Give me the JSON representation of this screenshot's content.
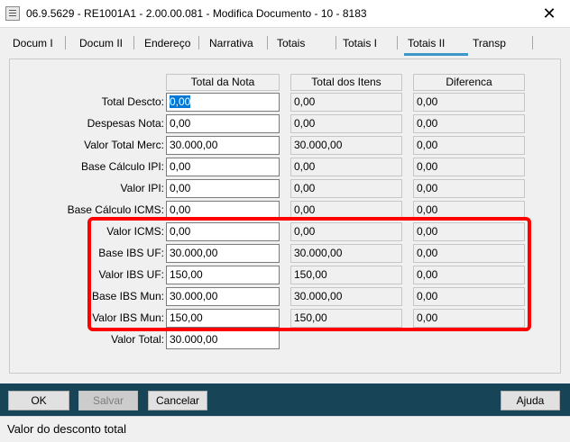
{
  "window": {
    "title": "06.9.5629 - RE1001A1 - 2.00.00.081 - Modifica Documento - 10 - 8183",
    "close_glyph": "✕"
  },
  "tabs": [
    {
      "label": "Docum I"
    },
    {
      "label": "Docum II"
    },
    {
      "label": "Endereço"
    },
    {
      "label": "Narrativa"
    },
    {
      "label": "Totais"
    },
    {
      "label": "Totais I"
    },
    {
      "label": "Totais II",
      "active": true
    },
    {
      "label": "Transp"
    }
  ],
  "grid": {
    "columns": [
      "Total da Nota",
      "Total dos Itens",
      "Diferenca"
    ],
    "rows": [
      {
        "label": "Total Descto:",
        "values": [
          "0,00",
          "0,00",
          "0,00"
        ]
      },
      {
        "label": "Despesas Nota:",
        "values": [
          "0,00",
          "0,00",
          "0,00"
        ]
      },
      {
        "label": "Valor Total Merc:",
        "values": [
          "30.000,00",
          "30.000,00",
          "0,00"
        ]
      },
      {
        "label": "Base Cálculo IPI:",
        "values": [
          "0,00",
          "0,00",
          "0,00"
        ]
      },
      {
        "label": "Valor IPI:",
        "values": [
          "0,00",
          "0,00",
          "0,00"
        ]
      },
      {
        "label": "Base Cálculo ICMS:",
        "values": [
          "0,00",
          "0,00",
          "0,00"
        ]
      },
      {
        "label": "Valor ICMS:",
        "values": [
          "0,00",
          "0,00",
          "0,00"
        ]
      },
      {
        "label": "Base IBS UF:",
        "values": [
          "30.000,00",
          "30.000,00",
          "0,00"
        ]
      },
      {
        "label": "Valor IBS UF:",
        "values": [
          "150,00",
          "150,00",
          "0,00"
        ]
      },
      {
        "label": "Base IBS Mun:",
        "values": [
          "30.000,00",
          "30.000,00",
          "0,00"
        ]
      },
      {
        "label": "Valor IBS Mun:",
        "values": [
          "150,00",
          "150,00",
          "0,00"
        ]
      }
    ],
    "total": {
      "label": "Valor Total:",
      "value": "30.000,00"
    }
  },
  "buttons": {
    "ok": "OK",
    "salvar": "Salvar",
    "cancelar": "Cancelar",
    "ajuda": "Ajuda"
  },
  "status": {
    "text": "Valor do desconto total"
  },
  "colors": {
    "highlight": "#ff0000",
    "bottom_bar": "#174457",
    "active_tab": "#3d97c8",
    "selection": "#0078d7"
  }
}
